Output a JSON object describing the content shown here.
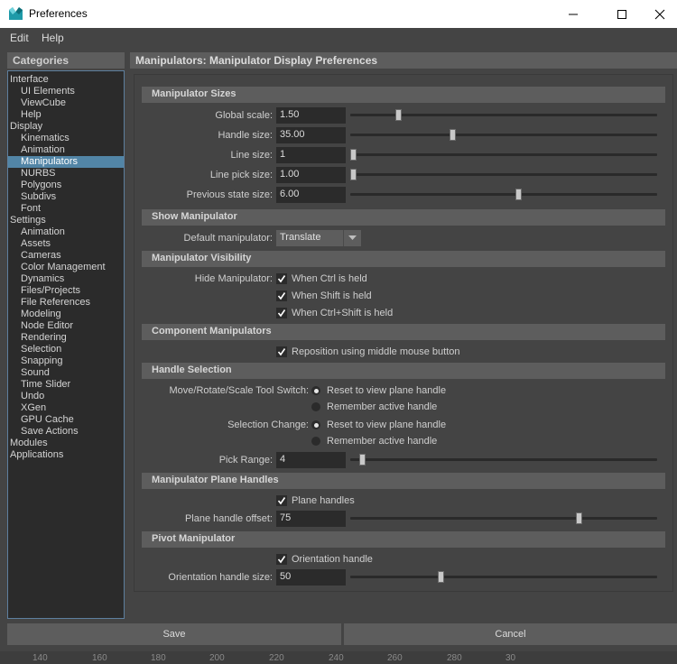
{
  "window": {
    "title": "Preferences"
  },
  "menubar": {
    "edit": "Edit",
    "help": "Help"
  },
  "categories": {
    "header": "Categories",
    "items": [
      {
        "label": "Interface",
        "level": 0
      },
      {
        "label": "UI Elements",
        "level": 1
      },
      {
        "label": "ViewCube",
        "level": 1
      },
      {
        "label": "Help",
        "level": 1
      },
      {
        "label": "Display",
        "level": 0
      },
      {
        "label": "Kinematics",
        "level": 1
      },
      {
        "label": "Animation",
        "level": 1
      },
      {
        "label": "Manipulators",
        "level": 1,
        "selected": true
      },
      {
        "label": "NURBS",
        "level": 1
      },
      {
        "label": "Polygons",
        "level": 1
      },
      {
        "label": "Subdivs",
        "level": 1
      },
      {
        "label": "Font",
        "level": 1
      },
      {
        "label": "Settings",
        "level": 0
      },
      {
        "label": "Animation",
        "level": 1
      },
      {
        "label": "Assets",
        "level": 1
      },
      {
        "label": "Cameras",
        "level": 1
      },
      {
        "label": "Color Management",
        "level": 1
      },
      {
        "label": "Dynamics",
        "level": 1
      },
      {
        "label": "Files/Projects",
        "level": 1
      },
      {
        "label": "File References",
        "level": 1
      },
      {
        "label": "Modeling",
        "level": 1
      },
      {
        "label": "Node Editor",
        "level": 1
      },
      {
        "label": "Rendering",
        "level": 1
      },
      {
        "label": "Selection",
        "level": 1
      },
      {
        "label": "Snapping",
        "level": 1
      },
      {
        "label": "Sound",
        "level": 1
      },
      {
        "label": "Time Slider",
        "level": 1
      },
      {
        "label": "Undo",
        "level": 1
      },
      {
        "label": "XGen",
        "level": 1
      },
      {
        "label": "GPU Cache",
        "level": 1
      },
      {
        "label": "Save Actions",
        "level": 1
      },
      {
        "label": "Modules",
        "level": 0
      },
      {
        "label": "Applications",
        "level": 0
      }
    ]
  },
  "panel": {
    "title": "Manipulators: Manipulator Display Preferences",
    "sizes": {
      "header": "Manipulator Sizes",
      "global_scale": {
        "label": "Global scale:",
        "value": "1.50",
        "fraction": 0.15
      },
      "handle_size": {
        "label": "Handle size:",
        "value": "35.00",
        "fraction": 0.33
      },
      "line_size": {
        "label": "Line size:",
        "value": "1",
        "fraction": 0.0
      },
      "line_pick_size": {
        "label": "Line pick size:",
        "value": "1.00",
        "fraction": 0.0
      },
      "previous_state_size": {
        "label": "Previous state size:",
        "value": "6.00",
        "fraction": 0.55
      }
    },
    "show": {
      "header": "Show Manipulator",
      "default_label": "Default manipulator:",
      "default_value": "Translate"
    },
    "visibility": {
      "header": "Manipulator Visibility",
      "hide_label": "Hide Manipulator:",
      "options": [
        {
          "label": "When Ctrl is held",
          "checked": true
        },
        {
          "label": "When Shift is held",
          "checked": true
        },
        {
          "label": "When Ctrl+Shift is held",
          "checked": true
        }
      ]
    },
    "component": {
      "header": "Component Manipulators",
      "reposition": {
        "label": "Reposition using middle mouse button",
        "checked": true
      }
    },
    "handle_selection": {
      "header": "Handle Selection",
      "move_label": "Move/Rotate/Scale Tool Switch:",
      "move_options": [
        {
          "label": "Reset to view plane handle",
          "selected": true
        },
        {
          "label": "Remember active handle",
          "selected": false
        }
      ],
      "sel_label": "Selection Change:",
      "sel_options": [
        {
          "label": "Reset to view plane handle",
          "selected": true
        },
        {
          "label": "Remember active handle",
          "selected": false
        }
      ],
      "pick_range": {
        "label": "Pick Range:",
        "value": "4",
        "fraction": 0.03
      }
    },
    "plane_handles": {
      "header": "Manipulator Plane Handles",
      "plane_handles": {
        "label": "Plane handles",
        "checked": true
      },
      "offset": {
        "label": "Plane handle offset:",
        "value": "75",
        "fraction": 0.75
      }
    },
    "pivot": {
      "header": "Pivot Manipulator",
      "orientation": {
        "label": "Orientation handle",
        "checked": true
      },
      "size": {
        "label": "Orientation handle size:",
        "value": "50",
        "fraction": 0.29
      }
    }
  },
  "buttons": {
    "save": "Save",
    "cancel": "Cancel"
  },
  "timeline": {
    "ticks": [
      "140",
      "160",
      "180",
      "200",
      "220",
      "240",
      "260",
      "280",
      "30"
    ]
  },
  "colors": {
    "accent": "#5285a6",
    "panel": "#444444",
    "field": "#2b2b2b",
    "header": "#5d5d5d"
  }
}
